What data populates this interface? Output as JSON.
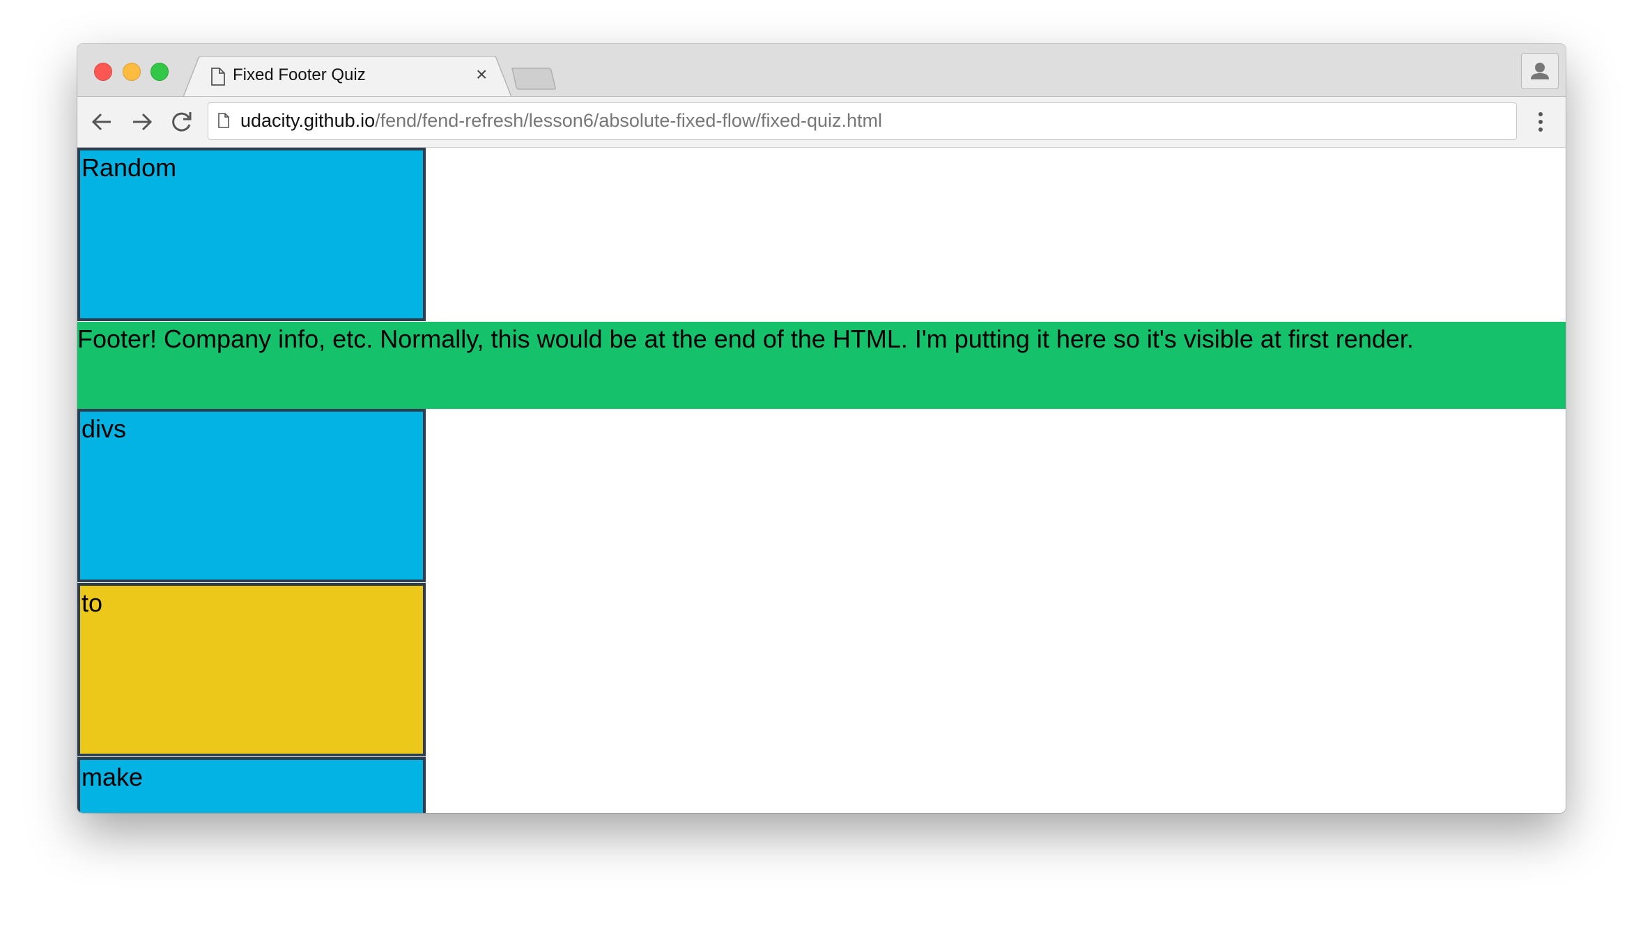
{
  "browser": {
    "tab_title": "Fixed Footer Quiz",
    "tab_close": "×",
    "url_host": "udacity.github.io",
    "url_path": "/fend/fend-refresh/lesson6/absolute-fixed-flow/fixed-quiz.html",
    "icons": [
      "page-icon",
      "close-icon",
      "back-arrow-icon",
      "forward-arrow-icon",
      "reload-icon",
      "profile-icon",
      "menu-dots-icon"
    ]
  },
  "page": {
    "boxes": [
      {
        "label": "Random",
        "color": "#02b3e4"
      },
      {
        "label": "divs",
        "color": "#02b3e4"
      },
      {
        "label": "to",
        "color": "#ecc81a"
      },
      {
        "label": "make",
        "color": "#02b3e4"
      }
    ],
    "footer": {
      "text": "Footer! Company info, etc. Normally, this would be at the end of the HTML. I'm putting it here so it's visible at first render.",
      "color": "#15c26b"
    },
    "border_color": "#2c3e50"
  }
}
